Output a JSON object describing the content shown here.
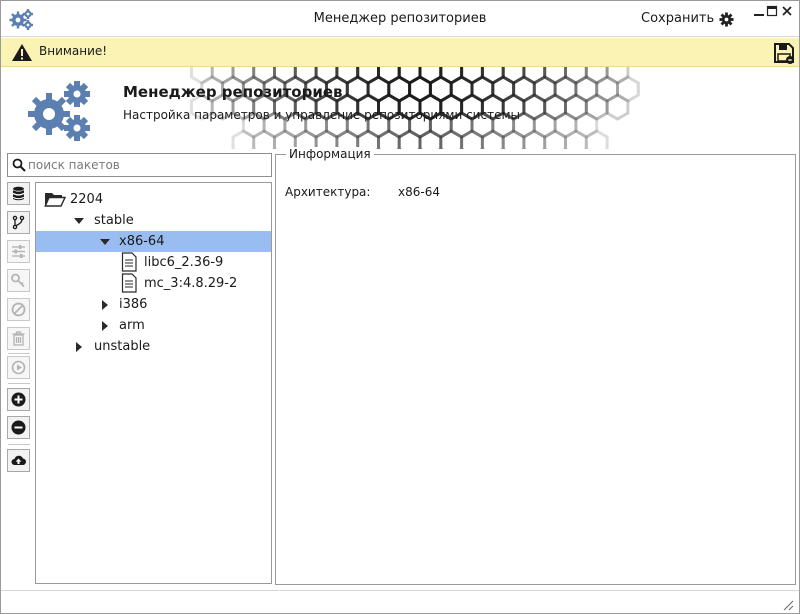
{
  "window": {
    "title": "Менеджер репозиториев",
    "save_label": "Сохранить",
    "icons": {
      "app": "gears-icon",
      "settings": "gear-icon",
      "minimize": "minimize-icon",
      "maximize": "maximize-icon",
      "close": "close-icon"
    }
  },
  "warning": {
    "text": "Внимание!",
    "icon": "warning-triangle-icon",
    "save_icon": "floppy-disk-icon",
    "background": "#fbf3b4"
  },
  "header": {
    "title": "Менеджер репозиториев",
    "subtitle": "Настройка параметров и управление репозиториями системы",
    "icon": "gears-icon",
    "accent": "#5b7fb1"
  },
  "search": {
    "placeholder": "поиск пакетов",
    "value": ""
  },
  "toolbar": [
    {
      "icon": "database-icon",
      "enabled": true
    },
    {
      "icon": "branch-icon",
      "enabled": true
    },
    {
      "icon": "sliders-icon",
      "enabled": false
    },
    {
      "icon": "key-icon",
      "enabled": false
    },
    {
      "icon": "ban-icon",
      "enabled": false
    },
    {
      "icon": "trash-icon",
      "enabled": false
    },
    {
      "icon": "play-icon",
      "enabled": false
    },
    {
      "icon": "plus-icon",
      "enabled": true
    },
    {
      "icon": "minus-icon",
      "enabled": true
    },
    {
      "icon": "cloud-upload-icon",
      "enabled": true
    }
  ],
  "tree": {
    "selection_color": "#99bdf0",
    "root": {
      "label": "2204",
      "icon": "folder-open-icon",
      "expanded": true
    },
    "stable": {
      "label": "stable",
      "expanded": true
    },
    "x86": {
      "label": "x86-64",
      "expanded": true,
      "selected": true
    },
    "file1": {
      "label": "libc6_2.36-9",
      "icon": "file-icon"
    },
    "file2": {
      "label": "mc_3:4.8.29-2",
      "icon": "file-icon"
    },
    "i386": {
      "label": "i386",
      "expanded": false
    },
    "arm": {
      "label": "arm",
      "expanded": false
    },
    "unstable": {
      "label": "unstable",
      "expanded": false
    }
  },
  "info": {
    "legend": "Информация",
    "rows": [
      {
        "key": "Архитектура:",
        "value": "x86-64"
      }
    ]
  },
  "statusbar": {
    "grip_icon": "resize-grip-icon"
  }
}
